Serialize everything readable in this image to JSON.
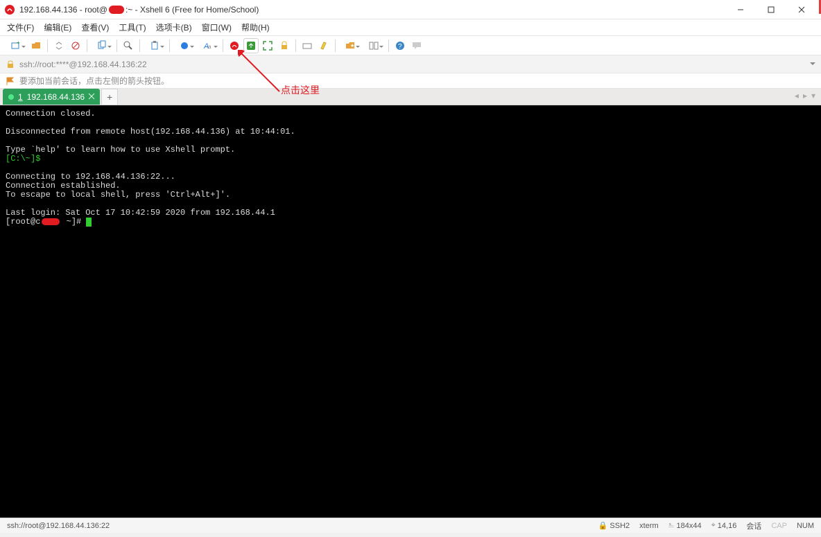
{
  "window": {
    "title_pre": "192.168.44.136 - root@",
    "title_post": ":~ - Xshell 6 (Free for Home/School)"
  },
  "menu": {
    "file": "文件(F)",
    "edit": "编辑(E)",
    "view": "查看(V)",
    "tools": "工具(T)",
    "tab": "选项卡(B)",
    "window": "窗口(W)",
    "help": "帮助(H)"
  },
  "address": {
    "url": "ssh://root:****@192.168.44.136:22"
  },
  "hint": {
    "text": "要添加当前会话，点击左侧的箭头按钮。"
  },
  "tabStrip": {
    "tab1_prefix": "1",
    "tab1_label": "192.168.44.136"
  },
  "annotation": {
    "label": "点击这里"
  },
  "terminal": {
    "l1": "Connection closed.",
    "l2": "",
    "l3": "Disconnected from remote host(192.168.44.136) at 10:44:01.",
    "l4": "",
    "l5": "Type `help' to learn how to use Xshell prompt.",
    "l6_prompt": "[C:\\~]$",
    "l7": "",
    "l8": "Connecting to 192.168.44.136:22...",
    "l9": "Connection established.",
    "l10": "To escape to local shell, press 'Ctrl+Alt+]'.",
    "l11": "",
    "l12": "Last login: Sat Oct 17 10:42:59 2020 from 192.168.44.1",
    "l13_p1": "[root@c",
    "l13_p2": " ~]# "
  },
  "status": {
    "left": "ssh://root@192.168.44.136:22",
    "ssh": "SSH2",
    "term": "xterm",
    "dims": "184x44",
    "cursor": "14,16",
    "session": "会话",
    "caps": "CAP",
    "num": "NUM"
  }
}
